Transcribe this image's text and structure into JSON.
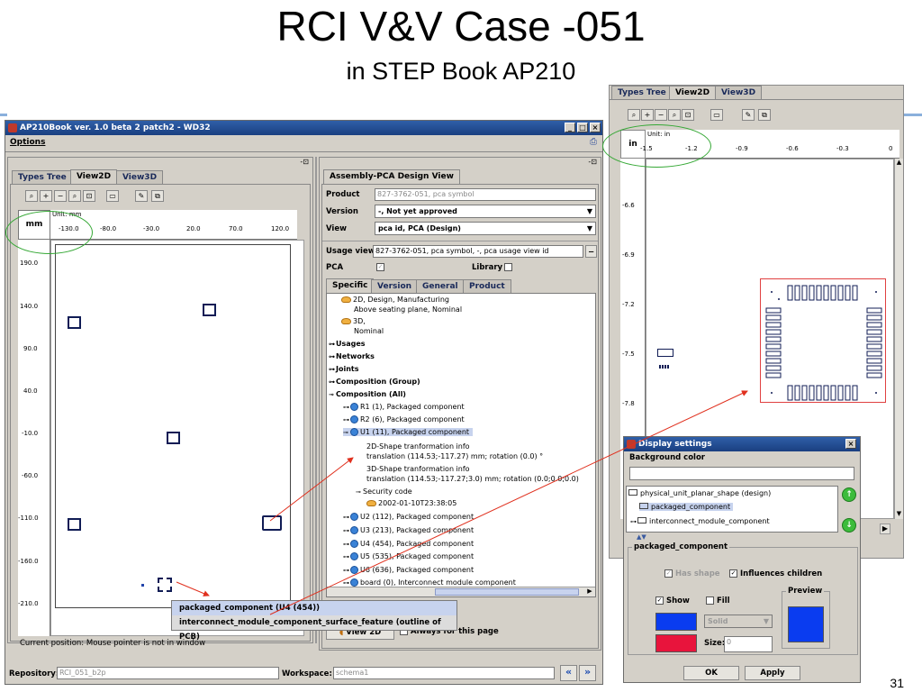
{
  "slide": {
    "title": "RCI V&V Case -051",
    "subtitle": "in STEP Book AP210",
    "page_number": "31"
  },
  "main_window": {
    "title": "AP210Book ver. 1.0 beta 2 patch2 - WD32",
    "menu_options": "Options",
    "tabs": [
      "Types Tree",
      "View2D",
      "View3D"
    ],
    "unit_label": "Unit: mm",
    "unit_short": "mm",
    "x_ticks": [
      "-130.0",
      "-80.0",
      "-30.0",
      "20.0",
      "70.0",
      "120.0"
    ],
    "y_ticks": [
      "190.0",
      "140.0",
      "90.0",
      "40.0",
      "-10.0",
      "-60.0",
      "-110.0",
      "-160.0",
      "-210.0"
    ],
    "current_position": "Current position:  Mouse pointer is not in window",
    "repository_label": "Repository:",
    "repository_value": "RCI_051_b2p",
    "workspace_label": "Workspace:",
    "workspace_value": "schema1"
  },
  "popup_menu": {
    "items": [
      "packaged_component (U4 (454))",
      "interconnect_module_component_surface_feature (outline of PCB)"
    ]
  },
  "assembly_panel": {
    "tab": "Assembly-PCA Design View",
    "product_label": "Product",
    "product_value": "827-3762-051, pca symbol",
    "version_label": "Version",
    "version_value": "-, Not yet approved",
    "view_label": "View",
    "view_value": "pca id, PCA (Design)",
    "usage_view_label": "Usage view",
    "usage_view_value": "827-3762-051, pca symbol, -, pca usage view id",
    "pca_label": "PCA",
    "library_label": "Library",
    "sub_tabs": [
      "Specific",
      "Version",
      "General",
      "Product"
    ],
    "tree": {
      "n1a": "2D, Design, Manufacturing",
      "n1b": "Above seating plane, Nominal",
      "n2a": "3D,",
      "n2b": "Nominal",
      "usages": "Usages",
      "networks": "Networks",
      "joints": "Joints",
      "comp_group": "Composition (Group)",
      "comp_all": "Composition (All)",
      "r1": "R1 (1), Packaged component",
      "r2": "R2 (6), Packaged component",
      "u1": "U1 (11), Packaged component",
      "shape2d": "2D-Shape tranformation info",
      "shape2d_val": "translation (114.53;-117.27) mm; rotation (0.0) °",
      "shape3d": "3D-Shape tranformation info",
      "shape3d_val": "translation (114.53;-117.27;3.0) mm; rotation (0.0;0.0;0.0)",
      "security": "Security code",
      "date": "2002-01-10T23:38:05",
      "u2": "U2 (112), Packaged component",
      "u3": "U3 (213), Packaged component",
      "u4": "U4 (454), Packaged component",
      "u5": "U5 (535), Packaged component",
      "u6": "U6 (636), Packaged component",
      "board": "board (0), Interconnect module component"
    },
    "view2d_button": "View 2D",
    "always_label": "Always for this page"
  },
  "right_view": {
    "tabs": [
      "Types Tree",
      "View2D",
      "View3D"
    ],
    "unit_label": "Unit: in",
    "unit_short": "in",
    "x_ticks": [
      "-1.5",
      "-1.2",
      "-0.9",
      "-0.6",
      "-0.3",
      "0"
    ],
    "y_ticks": [
      "-6.6",
      "-6.9",
      "-7.2",
      "-7.5",
      "-7.8"
    ]
  },
  "display_settings": {
    "title": "Display settings",
    "background_color_label": "Background color",
    "list": [
      "physical_unit_planar_shape (design)",
      "packaged_component",
      "interconnect_module_component"
    ],
    "group_label": "packaged_component",
    "has_shape": "Has shape",
    "influences_children": "Influences children",
    "preview": "Preview",
    "show": "Show",
    "fill": "Fill",
    "solid": "Solid",
    "size": "Size:",
    "size_value": "0",
    "ok": "OK",
    "apply": "Apply",
    "colors": {
      "show_color": "#0a3cf0",
      "fill_color": "#e8143c",
      "preview_color": "#0a3cf0"
    }
  }
}
